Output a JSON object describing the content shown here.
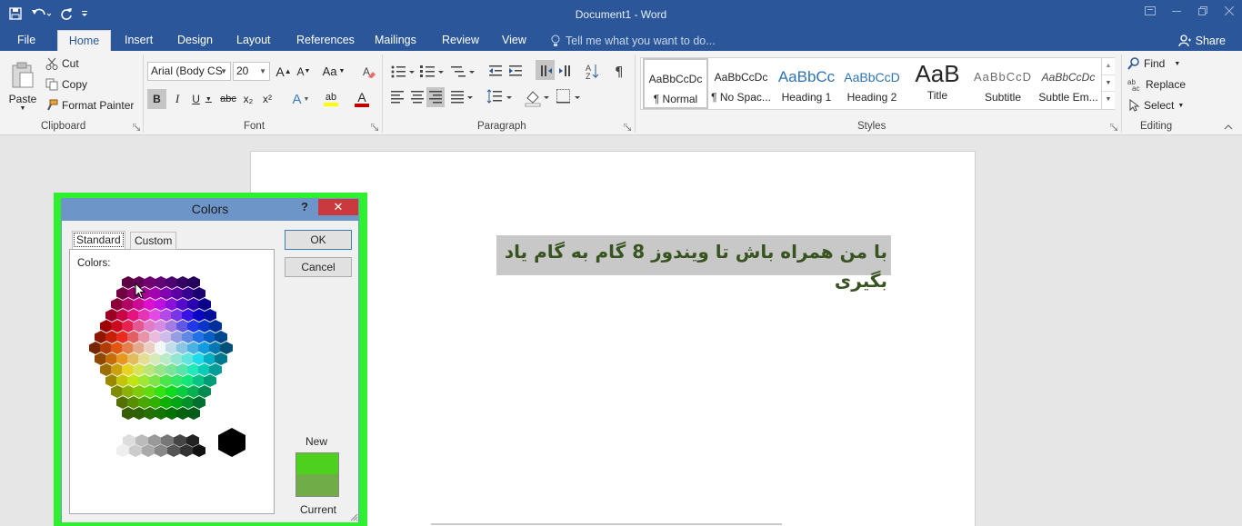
{
  "window": {
    "title": "Document1 - Word"
  },
  "tabs": [
    {
      "label": "File",
      "x": 0
    },
    {
      "label": "Home"
    },
    {
      "label": "Insert"
    },
    {
      "label": "Design"
    },
    {
      "label": "Layout"
    },
    {
      "label": "References"
    },
    {
      "label": "Mailings"
    },
    {
      "label": "Review"
    },
    {
      "label": "View"
    }
  ],
  "tell_me": "Tell me what you want to do...",
  "share": "Share",
  "clipboard": {
    "paste": "Paste",
    "cut": "Cut",
    "copy": "Copy",
    "format_painter": "Format Painter",
    "label": "Clipboard"
  },
  "font": {
    "name": "Arial (Body CS",
    "size": "20",
    "label": "Font",
    "bold": "B",
    "italic": "I",
    "underline": "U",
    "strike": "abc",
    "sub": "x₂",
    "sup": "x²",
    "case": "Aa",
    "grow": "A",
    "shrink": "A",
    "effects": "A",
    "highlight": "ab",
    "color": "A"
  },
  "paragraph": {
    "label": "Paragraph"
  },
  "styles": {
    "label": "Styles",
    "items": [
      {
        "preview": "AaBbCcDc",
        "name": "¶ Normal"
      },
      {
        "preview": "AaBbCcDc",
        "name": "¶ No Spac..."
      },
      {
        "preview": "AaBbCc",
        "name": "Heading 1"
      },
      {
        "preview": "AaBbCcD",
        "name": "Heading 2"
      },
      {
        "preview": "AaB",
        "name": "Title"
      },
      {
        "preview": "AaBbCcD",
        "name": "Subtitle"
      },
      {
        "preview": "AaBbCcDc",
        "name": "Subtle Em..."
      }
    ]
  },
  "editing": {
    "find": "Find",
    "replace": "Replace",
    "select": "Select",
    "label": "Editing"
  },
  "document": {
    "text": "با من همراه باش تا ویندوز 8 گام به گام یاد بگیری"
  },
  "dialog": {
    "title": "Colors",
    "help": "?",
    "close": "✕",
    "tab_standard": "Standard",
    "tab_custom": "Custom",
    "colors_label": "Colors:",
    "ok": "OK",
    "cancel": "Cancel",
    "new_label": "New",
    "current_label": "Current",
    "new_color": "#4ed11c",
    "current_color": "#70ad47"
  },
  "colors": {
    "accent": "#2b579a",
    "dialog_border": "#2ff02f",
    "text_highlight": "#c8c8c8",
    "text_color": "#37531f"
  }
}
